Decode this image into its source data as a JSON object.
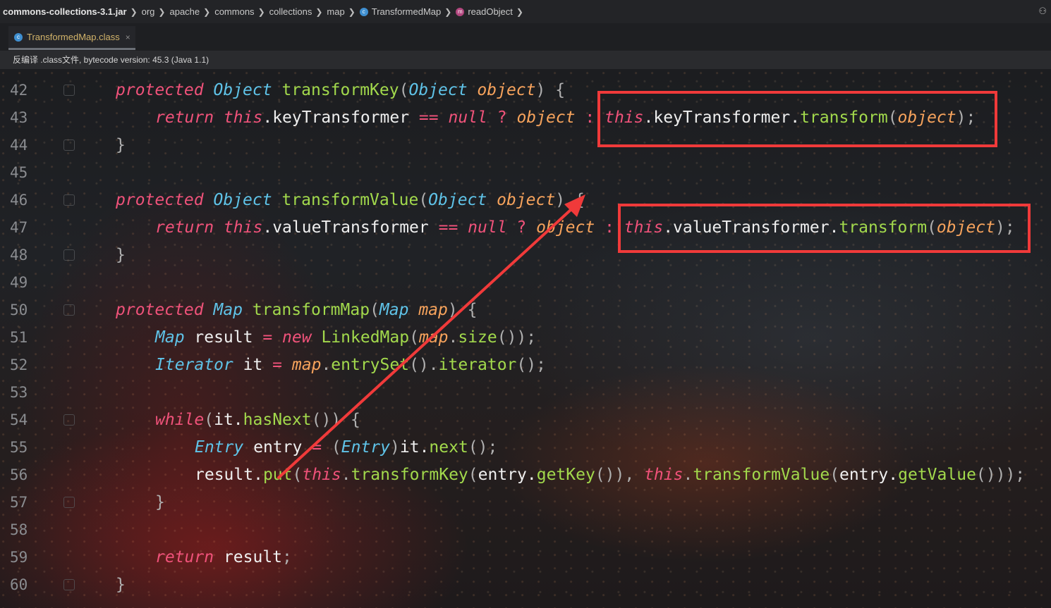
{
  "breadcrumb": {
    "jar": "commons-collections-3.1.jar",
    "pkg1": "org",
    "pkg2": "apache",
    "pkg3": "commons",
    "pkg4": "collections",
    "pkg5": "map",
    "cls": "TransformedMap",
    "method": "readObject",
    "class_icon_letter": "c",
    "method_icon_letter": "m"
  },
  "tab": {
    "label": "TransformedMap.class",
    "close": "×"
  },
  "banner": {
    "text": "反编译 .class文件, bytecode version: 45.3 (Java 1.1)"
  },
  "line_numbers": [
    "42",
    "43",
    "44",
    "45",
    "46",
    "47",
    "48",
    "49",
    "50",
    "51",
    "52",
    "53",
    "54",
    "55",
    "56",
    "57",
    "58",
    "59",
    "60"
  ],
  "code": {
    "l42": {
      "t1": "protected",
      "t2": "Object",
      "t3": "transformKey",
      "t4": "(",
      "t5": "Object",
      "t6": "object",
      "t7": ") {"
    },
    "l43": {
      "t1": "return",
      "t2": "this",
      "t3": ".keyTransformer ",
      "t4": "==",
      "t5": "null",
      "t6": "?",
      "t7": "object",
      "t8": ":",
      "t9": "this",
      "t10": ".keyTransformer.",
      "t11": "transform",
      "t12": "(",
      "t13": "object",
      "t14": ");"
    },
    "l44": {
      "t1": "}"
    },
    "l46": {
      "t1": "protected",
      "t2": "Object",
      "t3": "transformValue",
      "t4": "(",
      "t5": "Object",
      "t6": "object",
      "t7": ") {"
    },
    "l47": {
      "t1": "return",
      "t2": "this",
      "t3": ".valueTransformer ",
      "t4": "==",
      "t5": "null",
      "t6": "?",
      "t7": "object",
      "t8": ":",
      "t9": "this",
      "t10": ".valueTransformer.",
      "t11": "transform",
      "t12": "(",
      "t13": "object",
      "t14": ");"
    },
    "l48": {
      "t1": "}"
    },
    "l50": {
      "t1": "protected",
      "t2": "Map",
      "t3": "transformMap",
      "t4": "(",
      "t5": "Map",
      "t6": "map",
      "t7": ") {"
    },
    "l51": {
      "t1": "Map",
      "t2": " result ",
      "t3": "=",
      "t4": "new",
      "t5": "LinkedMap",
      "t6": "(",
      "t7": "map",
      "t8": ".",
      "t9": "size",
      "t10": "());"
    },
    "l52": {
      "t1": "Iterator",
      "t2": " it ",
      "t3": "=",
      "t4": "map",
      "t5": ".",
      "t6": "entrySet",
      "t7": "().",
      "t8": "iterator",
      "t9": "();"
    },
    "l54": {
      "t1": "while",
      "t2": "(",
      "t3": "it.",
      "t4": "hasNext",
      "t5": "()) {"
    },
    "l55": {
      "t1": "Entry",
      "t2": " entry ",
      "t3": "=",
      "t4": "(",
      "t5": "Entry",
      "t6": ")",
      "t7": "it.",
      "t8": "next",
      "t9": "();"
    },
    "l56": {
      "t1": "result.",
      "t2": "put",
      "t3": "(",
      "t4": "this",
      "t5": ".",
      "t6": "transformKey",
      "t7": "(",
      "t8": "entry.",
      "t9": "getKey",
      "t10": "()), ",
      "t11": "this",
      "t12": ".",
      "t13": "transformValue",
      "t14": "(",
      "t15": "entry.",
      "t16": "getValue",
      "t17": "()));"
    },
    "l57": {
      "t1": "}"
    },
    "l59": {
      "t1": "return",
      "t2": " result",
      "t3": ";"
    },
    "l60": {
      "t1": "}"
    }
  },
  "colors": {
    "keyword": "#f0527a",
    "type": "#5fc3e8",
    "function": "#a2d94c",
    "parameter": "#f7a35c",
    "annotation": "#f03a3a"
  }
}
